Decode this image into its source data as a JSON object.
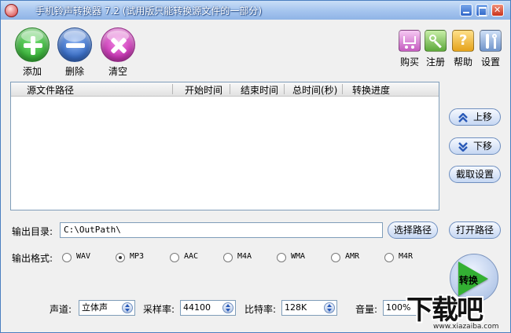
{
  "window": {
    "title": "手机铃声转换器 7.2 (试用版只能转换源文件的一部分)"
  },
  "toolbar": {
    "add_label": "添加",
    "delete_label": "删除",
    "clear_label": "清空",
    "buy_label": "购买",
    "register_label": "注册",
    "help_label": "帮助",
    "settings_label": "设置"
  },
  "file_list": {
    "columns": [
      "源文件路径",
      "开始时间",
      "结束时间",
      "总时间(秒)",
      "转换进度"
    ],
    "rows": []
  },
  "side_buttons": {
    "move_up": "上移",
    "move_down": "下移",
    "clip_settings": "截取设置",
    "open_path": "打开路径",
    "convert": "转换"
  },
  "output": {
    "dir_label": "输出目录:",
    "dir_value": "C:\\OutPath\\",
    "choose_path": "选择路径",
    "format_label": "输出格式:",
    "formats": [
      "WAV",
      "MP3",
      "AAC",
      "M4A",
      "WMA",
      "AMR",
      "M4R"
    ],
    "selected_format": "MP3"
  },
  "audio": {
    "channel_label": "声道:",
    "channel_value": "立体声",
    "samplerate_label": "采样率:",
    "samplerate_value": "44100",
    "bitrate_label": "比特率:",
    "bitrate_value": "128K",
    "volume_label": "音量:",
    "volume_value": "100%"
  },
  "watermark": {
    "brand": "下载吧",
    "url": "www.xiazaiba.com"
  },
  "colors": {
    "titlebar": "#a4c4ee",
    "add": "#3cb43c",
    "delete": "#3a6fc8",
    "clear": "#cc3ab8",
    "convert_play": "#33b033"
  }
}
